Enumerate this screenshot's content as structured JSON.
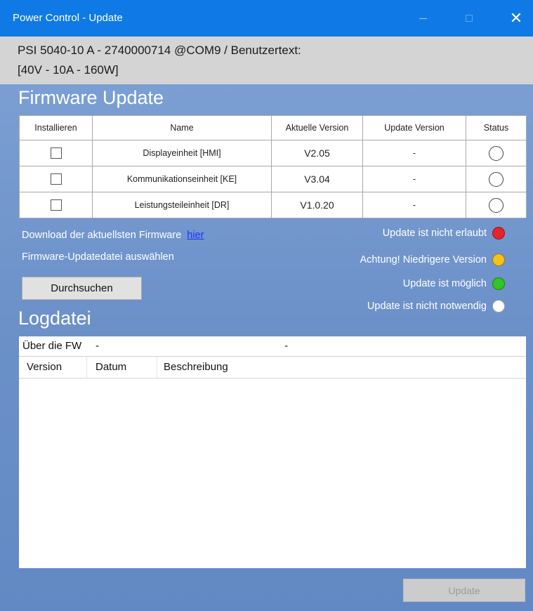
{
  "window": {
    "title": "Power Control - Update",
    "minimize_icon": "minimize-icon",
    "maximize_icon": "maximize-icon",
    "close_glyph": "✕"
  },
  "device": {
    "line1": "PSI 5040-10 A - 2740000714 @COM9 / Benutzertext:",
    "line2": "[40V - 10A - 160W]"
  },
  "firmware": {
    "heading": "Firmware Update",
    "columns": [
      "Installieren",
      "Name",
      "Aktuelle Version",
      "Update Version",
      "Status"
    ],
    "rows": [
      {
        "name": "Displayeinheit [HMI]",
        "current": "V2.05",
        "update": "-"
      },
      {
        "name": "Kommunikationseinheit [KE]",
        "current": "V3.04",
        "update": "-"
      },
      {
        "name": "Leistungsteileinheit [DR]",
        "current": "V1.0.20",
        "update": "-"
      }
    ]
  },
  "download": {
    "text": "Download der aktuellsten Firmware",
    "link": "hier"
  },
  "select_file": {
    "text": "Firmware-Updatedatei auswählen",
    "browse_label": "Durchsuchen"
  },
  "legend": [
    {
      "label": "Update ist nicht erlaubt",
      "color": "#e8242a"
    },
    {
      "label": "Achtung! Niedrigere Version",
      "color": "#f4c21a"
    },
    {
      "label": "Update ist möglich",
      "color": "#34c424"
    },
    {
      "label": "Update ist nicht notwendig",
      "color": "#ffffff"
    }
  ],
  "log": {
    "heading": "Logdatei",
    "about_label": "Über die FW",
    "about_value1": "-",
    "about_value2": "-",
    "columns": [
      "Version",
      "Datum",
      "Beschreibung"
    ]
  },
  "update_button": "Update",
  "colors": {
    "titlebar": "#0f7ae5",
    "panel": "#6f95cc",
    "link": "#1e30ff"
  }
}
